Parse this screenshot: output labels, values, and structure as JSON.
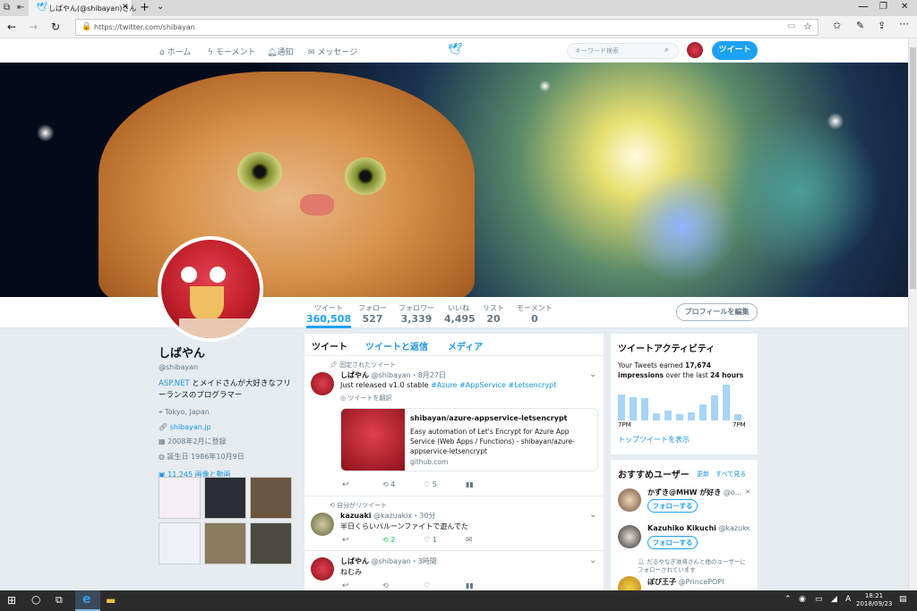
{
  "browser": {
    "tab_title": "しばやん(@shibayan)さん",
    "url": "https://twitter.com/shibayan"
  },
  "nav": {
    "home": "ホーム",
    "moments": "モーメント",
    "notifications": "通知",
    "messages": "メッセージ",
    "search_placeholder": "キーワード検索",
    "tweet_button": "ツイート"
  },
  "stats": [
    {
      "label": "ツイート",
      "value": "360,508"
    },
    {
      "label": "フォロー",
      "value": "527"
    },
    {
      "label": "フォロワー",
      "value": "3,339"
    },
    {
      "label": "いいね",
      "value": "4,495"
    },
    {
      "label": "リスト",
      "value": "20"
    },
    {
      "label": "モーメント",
      "value": "0"
    }
  ],
  "edit_profile": "プロフィールを編集",
  "profile": {
    "name": "しばやん",
    "handle": "@shibayan",
    "bio_link": "ASP.NET",
    "bio": " とメイドさんが大好きなフリーランスのプログラマー",
    "location": "Tokyo, Japan",
    "website": "shibayan.jp",
    "joined": "2008年2月に登録",
    "birthday": "誕生日 1986年10月9日",
    "media": "11,245 画像と動画"
  },
  "timeline_tabs": [
    "ツイート",
    "ツイートと返信",
    "メディア"
  ],
  "tweets": [
    {
      "context": "固定されたツイート",
      "name": "しばやん",
      "handle": "@shibayan",
      "time": "・8月27日",
      "text": "Just released v1.0 stable ",
      "hashtags": "#Azure #AppService #Letsencrypt",
      "translate": "ツイートを翻訳",
      "card_title": "shibayan/azure-appservice-letsencrypt",
      "card_desc": "Easy automation of Let's Encrypt for Azure App Service (Web Apps / Functions) - shibayan/azure-appservice-letsencrypt",
      "card_domain": "github.com",
      "retweets": "4",
      "likes": "5"
    },
    {
      "context": "自分がリツイート",
      "name": "kazuaki",
      "handle": "@kazuakix",
      "time": "・30分",
      "text": "半日くらいバルーンファイトで遊んでた",
      "retweets": "2",
      "likes": "1"
    },
    {
      "name": "しばやん",
      "handle": "@shibayan",
      "time": "・3時間",
      "text": "ねむみ"
    }
  ],
  "activity": {
    "title": "ツイートアクティビティ",
    "line1_pre": "Your Tweets earned ",
    "count": "17,674",
    "line2_pre": "impressions",
    "line2_mid": " over the last ",
    "hours": "24 hours",
    "axis_left": "7PM",
    "axis_right": "7PM",
    "link": "トップツイートを表示",
    "bars": [
      28,
      25,
      24,
      8,
      10,
      7,
      9,
      17,
      27,
      38,
      7
    ]
  },
  "suggest": {
    "title": "おすすめユーザー",
    "refresh": "更新",
    "view_all": "すべて見る",
    "users": [
      {
        "name": "かずき@MHW が好き",
        "handle": "@o...",
        "follow": "フォローする"
      },
      {
        "name": "Kazuhiko Kikuchi",
        "handle": "@kazuk",
        "follow": "フォローする"
      },
      {
        "name": "ぼび王子",
        "handle": "@PrincePOPI",
        "note": "だるやなぎ准将さんと他のユーザーにフォローされています"
      }
    ]
  },
  "taskbar": {
    "time": "18:21",
    "date": "2018/09/23",
    "ime": "A"
  }
}
